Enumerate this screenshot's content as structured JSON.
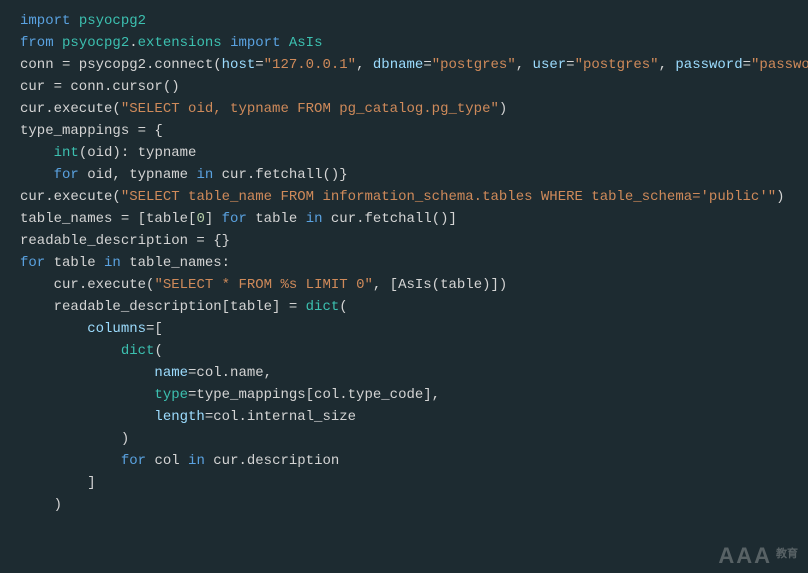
{
  "watermark": {
    "main": "AAA",
    "sub": "教育"
  },
  "code": {
    "lines": [
      {
        "indent": 0,
        "tokens": [
          {
            "t": "import ",
            "c": "kw"
          },
          {
            "t": "psyocpg2",
            "c": "lib"
          }
        ]
      },
      {
        "indent": 0,
        "tokens": [
          {
            "t": "from ",
            "c": "kw"
          },
          {
            "t": "psyocpg2",
            "c": "lib"
          },
          {
            "t": ".",
            "c": "txt"
          },
          {
            "t": "extensions ",
            "c": "lib"
          },
          {
            "t": "import ",
            "c": "kw"
          },
          {
            "t": "AsIs",
            "c": "lib"
          }
        ]
      },
      {
        "indent": 0,
        "tokens": [
          {
            "t": "conn = psycopg2.connect(",
            "c": "txt"
          },
          {
            "t": "host",
            "c": "var"
          },
          {
            "t": "=",
            "c": "txt"
          },
          {
            "t": "\"127.0.0.1\"",
            "c": "str"
          },
          {
            "t": ", ",
            "c": "txt"
          },
          {
            "t": "dbname",
            "c": "var"
          },
          {
            "t": "=",
            "c": "txt"
          },
          {
            "t": "\"postgres\"",
            "c": "str"
          },
          {
            "t": ", ",
            "c": "txt"
          },
          {
            "t": "user",
            "c": "var"
          },
          {
            "t": "=",
            "c": "txt"
          },
          {
            "t": "\"postgres\"",
            "c": "str"
          },
          {
            "t": ", ",
            "c": "txt"
          },
          {
            "t": "password",
            "c": "var"
          },
          {
            "t": "=",
            "c": "txt"
          },
          {
            "t": "\"password\"",
            "c": "str"
          },
          {
            "t": ")",
            "c": "txt"
          }
        ]
      },
      {
        "indent": 0,
        "tokens": [
          {
            "t": "cur = conn.cursor()",
            "c": "txt"
          }
        ]
      },
      {
        "indent": 0,
        "tokens": [
          {
            "t": "cur.execute(",
            "c": "txt"
          },
          {
            "t": "\"SELECT oid, typname FROM pg_catalog.pg_type\"",
            "c": "str"
          },
          {
            "t": ")",
            "c": "txt"
          }
        ]
      },
      {
        "indent": 0,
        "tokens": [
          {
            "t": "type_mappings = {",
            "c": "txt"
          }
        ]
      },
      {
        "indent": 1,
        "tokens": [
          {
            "t": "int",
            "c": "lib"
          },
          {
            "t": "(oid): typname",
            "c": "txt"
          }
        ]
      },
      {
        "indent": 1,
        "tokens": [
          {
            "t": "for ",
            "c": "kw"
          },
          {
            "t": "oid, typname ",
            "c": "txt"
          },
          {
            "t": "in ",
            "c": "kw"
          },
          {
            "t": "cur.fetchall()}",
            "c": "txt"
          }
        ]
      },
      {
        "indent": 0,
        "tokens": [
          {
            "t": "cur.execute(",
            "c": "txt"
          },
          {
            "t": "\"SELECT table_name FROM information_schema.tables WHERE table_schema='public'\"",
            "c": "str"
          },
          {
            "t": ")",
            "c": "txt"
          }
        ]
      },
      {
        "indent": 0,
        "tokens": [
          {
            "t": "table_names = [table[",
            "c": "txt"
          },
          {
            "t": "0",
            "c": "num"
          },
          {
            "t": "] ",
            "c": "txt"
          },
          {
            "t": "for ",
            "c": "kw"
          },
          {
            "t": "table ",
            "c": "txt"
          },
          {
            "t": "in ",
            "c": "kw"
          },
          {
            "t": "cur.fetchall()]",
            "c": "txt"
          }
        ]
      },
      {
        "indent": 0,
        "tokens": [
          {
            "t": "readable_description = {}",
            "c": "txt"
          }
        ]
      },
      {
        "indent": 0,
        "tokens": [
          {
            "t": "for ",
            "c": "kw"
          },
          {
            "t": "table ",
            "c": "txt"
          },
          {
            "t": "in ",
            "c": "kw"
          },
          {
            "t": "table_names:",
            "c": "txt"
          }
        ]
      },
      {
        "indent": 1,
        "tokens": [
          {
            "t": "cur.execute(",
            "c": "txt"
          },
          {
            "t": "\"SELECT * FROM %s LIMIT 0\"",
            "c": "str"
          },
          {
            "t": ", [AsIs(table)])",
            "c": "txt"
          }
        ]
      },
      {
        "indent": 1,
        "tokens": [
          {
            "t": "readable_description[table] = ",
            "c": "txt"
          },
          {
            "t": "dict",
            "c": "lib"
          },
          {
            "t": "(",
            "c": "txt"
          }
        ]
      },
      {
        "indent": 2,
        "tokens": [
          {
            "t": "columns",
            "c": "var"
          },
          {
            "t": "=[",
            "c": "txt"
          }
        ]
      },
      {
        "indent": 3,
        "tokens": [
          {
            "t": "dict",
            "c": "lib"
          },
          {
            "t": "(",
            "c": "txt"
          }
        ]
      },
      {
        "indent": 4,
        "tokens": [
          {
            "t": "name",
            "c": "var"
          },
          {
            "t": "=col.name,",
            "c": "txt"
          }
        ]
      },
      {
        "indent": 4,
        "tokens": [
          {
            "t": "type",
            "c": "lib"
          },
          {
            "t": "=type_mappings[col.type_code],",
            "c": "txt"
          }
        ]
      },
      {
        "indent": 4,
        "tokens": [
          {
            "t": "length",
            "c": "var"
          },
          {
            "t": "=col.internal_size",
            "c": "txt"
          }
        ]
      },
      {
        "indent": 3,
        "tokens": [
          {
            "t": ")",
            "c": "txt"
          }
        ]
      },
      {
        "indent": 3,
        "tokens": [
          {
            "t": "for ",
            "c": "kw"
          },
          {
            "t": "col ",
            "c": "txt"
          },
          {
            "t": "in ",
            "c": "kw"
          },
          {
            "t": "cur.description",
            "c": "txt"
          }
        ]
      },
      {
        "indent": 2,
        "tokens": [
          {
            "t": "]",
            "c": "txt"
          }
        ]
      },
      {
        "indent": 1,
        "tokens": [
          {
            "t": ")",
            "c": "txt"
          }
        ]
      }
    ]
  }
}
